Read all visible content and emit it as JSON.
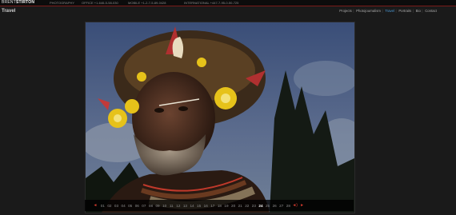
{
  "header": {
    "logo_first": "BRENT",
    "logo_second": "STIRTON",
    "tagline": "PHOTOGRAPHY",
    "office": "OFFICE +1-646-5-58-030",
    "mobile": "MOBILE +1-2-7-5-89-0428",
    "international": "INTERNATIONAL +447-7-95-0-50-725"
  },
  "section_title": "Travel",
  "nav": {
    "items": [
      {
        "label": "Projects",
        "active": false
      },
      {
        "label": "Photojournalism",
        "active": false
      },
      {
        "label": "Travel",
        "active": true
      },
      {
        "label": "Portraits",
        "active": false
      },
      {
        "label": "Bio",
        "active": false
      },
      {
        "label": "Contact",
        "active": false
      }
    ]
  },
  "photo": {
    "subject": "portrait-headdress"
  },
  "pager": {
    "prev_symbol": "◄",
    "next_symbol": "►",
    "sound_symbol": "◄)",
    "current": "24",
    "pages": [
      "01",
      "02",
      "03",
      "04",
      "05",
      "06",
      "07",
      "08",
      "09",
      "10",
      "11",
      "12",
      "13",
      "14",
      "15",
      "16",
      "17",
      "18",
      "19",
      "20",
      "21",
      "22",
      "23",
      "24",
      "25",
      "26",
      "27",
      "28"
    ]
  },
  "colors": {
    "accent_red": "#d63b2e",
    "nav_active": "#4c9ad6",
    "background": "#1a1a1a"
  }
}
